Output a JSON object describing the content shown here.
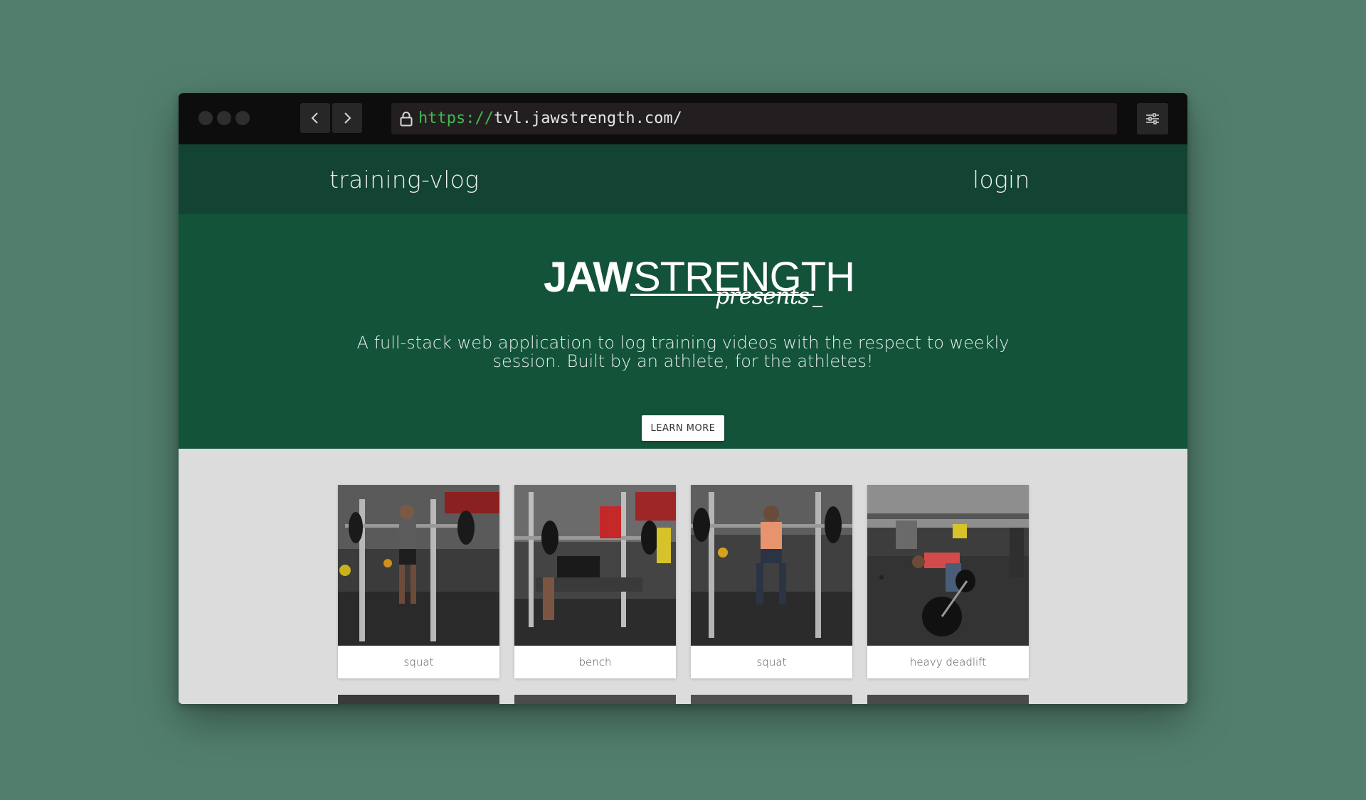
{
  "browser": {
    "url_scheme": "https://",
    "url_rest": "tvl.jawstrength.com/"
  },
  "nav": {
    "brand_link": "training-vlog",
    "login_link": "login"
  },
  "hero": {
    "logo_primary": "JAW",
    "logo_secondary": "STRENGTH",
    "logo_script": "presents",
    "tagline": "A full-stack web application to log training videos with the respect to weekly session. Built by an athlete, for the athletes!",
    "cta_label": "LEARN MORE"
  },
  "videos": [
    {
      "label": "squat"
    },
    {
      "label": "bench"
    },
    {
      "label": "squat"
    },
    {
      "label": "heavy deadlift"
    }
  ],
  "colors": {
    "desktop_bg": "#527f6d",
    "nav_bg": "#134332",
    "hero_bg": "#125339",
    "url_scheme": "#3fb950"
  }
}
